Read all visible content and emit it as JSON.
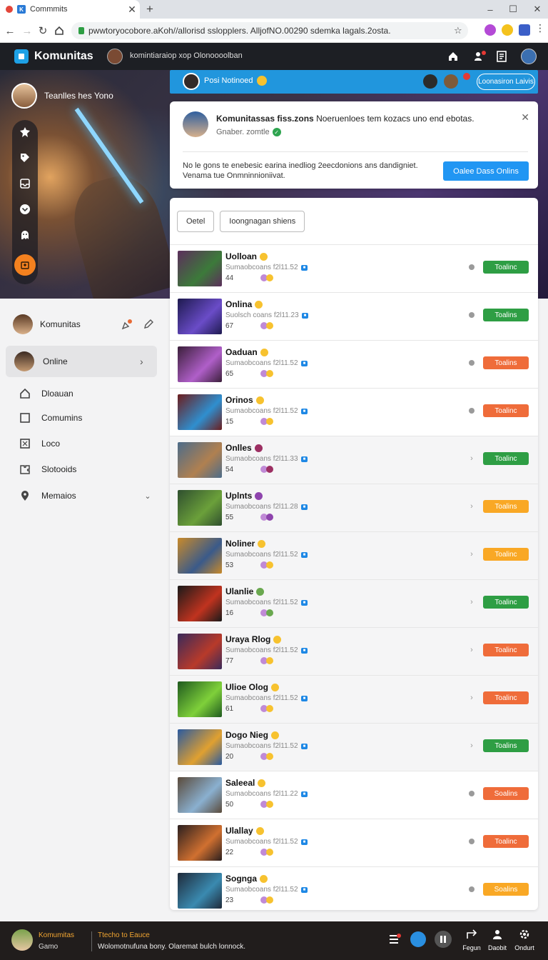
{
  "browser": {
    "tab_title": "Commmits",
    "url": "pwwtoryocobore.aKoh//allorisd sslopplers. AlljofNO.00290 sdemka lagals.2osta."
  },
  "app": {
    "brand": "Komunitas",
    "header_subtitle": "komintiaraiop xop Olonoooolban"
  },
  "hero": {
    "user_name": "Teanlles hes Yono"
  },
  "promo": {
    "text": "Posi Notinoed",
    "button": "Loonasiron Laivis"
  },
  "notification": {
    "title_bold": "Komunitassas fiss.zons",
    "title_rest": "Noeruenloes tem kozacs uno end ebotas.",
    "meta": "Gnaber. zomtle",
    "body": "No le gons te enebesic earina inedliog 2eecdonions ans dandigniet. Venama tue Onmninnioniivat.",
    "cta": "Oalee Dass Onlins"
  },
  "sidebar": {
    "header": "Komunitas",
    "online": "Online",
    "items": [
      {
        "label": "Dloauan",
        "icon": "home-icon"
      },
      {
        "label": "Comumins",
        "icon": "square-icon"
      },
      {
        "label": "Loco",
        "icon": "grid-icon"
      },
      {
        "label": "Slotooids",
        "icon": "puzzle-icon"
      },
      {
        "label": "Memaios",
        "icon": "pin-icon"
      }
    ]
  },
  "filters": [
    "Oetel",
    "Ioongnagan shiens"
  ],
  "rows": [
    {
      "name": "Uolloan",
      "sub": "Sumaobcoans f2l11.52",
      "count": "44",
      "status": "Toalinc",
      "color": "#2e9e44",
      "mark": "dot",
      "emoji_color": "#f7c22f",
      "thumb": "#5c2e5c",
      "thumb2": "#3c7a3a"
    },
    {
      "name": "Onlina",
      "sub": "Suolsch coans f2l11.23",
      "count": "67",
      "status": "Toalins",
      "color": "#2e9e44",
      "mark": "dot",
      "emoji_color": "#f7c22f",
      "thumb": "#1e1a4f",
      "thumb2": "#6a4cc8"
    },
    {
      "name": "Oaduan",
      "sub": "Sumaobcoans f2l11.52",
      "count": "65",
      "status": "Toalins",
      "color": "#ef6c3a",
      "mark": "dot",
      "emoji_color": "#f7c22f",
      "thumb": "#3b1f3a",
      "thumb2": "#b05fc9"
    },
    {
      "name": "Orinos",
      "sub": "Sumaobcoans f2l11.52",
      "count": "15",
      "status": "Toalinc",
      "color": "#ef6c3a",
      "mark": "dot",
      "emoji_color": "#f7c22f",
      "thumb": "#6c1d1d",
      "thumb2": "#2f8fcf"
    },
    {
      "name": "Onlles",
      "sub": "Sumaobcoans f2l11.33",
      "count": "54",
      "status": "Toalinc",
      "color": "#2e9e44",
      "mark": "chev",
      "emoji_color": "#9c2f62",
      "thumb": "#4c6c8a",
      "thumb2": "#b08050"
    },
    {
      "name": "Uplnts",
      "sub": "Sumaobcoans f2l11.28",
      "count": "55",
      "status": "Toalins",
      "color": "#f9a825",
      "mark": "chev",
      "emoji_color": "#8e44ad",
      "thumb": "#2f4f2f",
      "thumb2": "#6ba03a"
    },
    {
      "name": "Noliner",
      "sub": "Sumaobcoans f2l11.52",
      "count": "53",
      "status": "Toalinc",
      "color": "#f9a825",
      "mark": "chev",
      "emoji_color": "#f7c22f",
      "thumb": "#c98a2a",
      "thumb2": "#3a5a8a"
    },
    {
      "name": "Ulanlie",
      "sub": "Sumaobcoans f2l11.52",
      "count": "16",
      "status": "Toalinc",
      "color": "#2e9e44",
      "mark": "chev",
      "emoji_color": "#6aa84f",
      "thumb": "#1a1a1a",
      "thumb2": "#c0331f"
    },
    {
      "name": "Uraya Rlog",
      "sub": "Sumaobcoans f2l11.52",
      "count": "77",
      "status": "Toalinc",
      "color": "#ef6c3a",
      "mark": "chev",
      "emoji_color": "#f7c22f",
      "thumb": "#3a2a5a",
      "thumb2": "#b83a2a"
    },
    {
      "name": "Ulioe Olog",
      "sub": "Sumaobcoans f2l11.52",
      "count": "61",
      "status": "Toalinc",
      "color": "#ef6c3a",
      "mark": "chev",
      "emoji_color": "#f7c22f",
      "thumb": "#1f5a1f",
      "thumb2": "#7fd03a"
    },
    {
      "name": "Dogo Nieg",
      "sub": "Sumaobcoans f2l11.52",
      "count": "20",
      "status": "Toalins",
      "color": "#2e9e44",
      "mark": "chev",
      "emoji_color": "#f7c22f",
      "thumb": "#2a5aa0",
      "thumb2": "#e0a030"
    },
    {
      "name": "Saleeal",
      "sub": "Sumaobcoans f2l11.22",
      "count": "50",
      "status": "Soalins",
      "color": "#ef6c3a",
      "mark": "dot",
      "emoji_color": "#f7c22f",
      "thumb": "#5a4a3a",
      "thumb2": "#8ab0d0"
    },
    {
      "name": "Ulallay",
      "sub": "Sumaobcoans f2l11.52",
      "count": "22",
      "status": "Toalinc",
      "color": "#ef6c3a",
      "mark": "dot",
      "emoji_color": "#f7c22f",
      "thumb": "#2a1f1f",
      "thumb2": "#d07030"
    },
    {
      "name": "Sognga",
      "sub": "Sumaobcoans f2l11.52",
      "count": "23",
      "status": "Soalins",
      "color": "#f9a825",
      "mark": "dot",
      "emoji_color": "#f7c22f",
      "thumb": "#1f2a3a",
      "thumb2": "#3a8ab0"
    }
  ],
  "bottombar": {
    "name": "Komumitas",
    "sub": "Gamo",
    "line1": "Ttecho to Eauce",
    "line2": "Wolomotnufuna bony. Olaremat bulch lonnock.",
    "actions": [
      "Fegun",
      "Daobit",
      "Ondurt"
    ]
  }
}
